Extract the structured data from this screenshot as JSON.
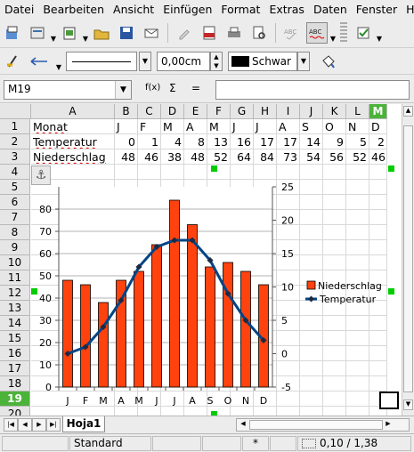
{
  "menu": [
    "Datei",
    "Bearbeiten",
    "Ansicht",
    "Einfügen",
    "Format",
    "Extras",
    "Daten",
    "Fenster",
    "Hilfe"
  ],
  "line_width": "0,00cm",
  "line_color": "Schwar",
  "name_box": "M19",
  "formula_buttons": {
    "function": "f(x)",
    "sum": "Σ",
    "equals": "="
  },
  "columns": [
    "A",
    "B",
    "C",
    "D",
    "E",
    "F",
    "G",
    "H",
    "I",
    "J",
    "K",
    "L",
    "M"
  ],
  "rows": [
    "1",
    "2",
    "3",
    "4",
    "5",
    "6",
    "7",
    "8",
    "9",
    "10",
    "11",
    "12",
    "13",
    "14",
    "15",
    "16",
    "17",
    "18",
    "19",
    "20"
  ],
  "sheet": {
    "row1": [
      "Monat",
      "J",
      "F",
      "M",
      "A",
      "M",
      "J",
      "J",
      "A",
      "S",
      "O",
      "N",
      "D"
    ],
    "row2": [
      "Temperatur",
      "0",
      "1",
      "4",
      "8",
      "13",
      "16",
      "17",
      "17",
      "14",
      "9",
      "5",
      "2"
    ],
    "row3": [
      "Niederschlag",
      "48",
      "46",
      "38",
      "48",
      "52",
      "64",
      "84",
      "73",
      "54",
      "56",
      "52",
      "46"
    ]
  },
  "chart_data": {
    "type": "bar",
    "categories": [
      "J",
      "F",
      "M",
      "A",
      "M",
      "J",
      "J",
      "A",
      "S",
      "O",
      "N",
      "D"
    ],
    "series": [
      {
        "name": "Niederschlag",
        "type": "bar",
        "axis": "left",
        "color": "#ff420e",
        "values": [
          48,
          46,
          38,
          48,
          52,
          64,
          84,
          73,
          54,
          56,
          52,
          46
        ]
      },
      {
        "name": "Temperatur",
        "type": "line",
        "axis": "right",
        "color": "#004586",
        "values": [
          0,
          1,
          4,
          8,
          13,
          16,
          17,
          17,
          14,
          9,
          5,
          2
        ]
      }
    ],
    "y_left": {
      "min": 0,
      "max": 90,
      "ticks": [
        0,
        10,
        20,
        30,
        40,
        50,
        60,
        70,
        80
      ]
    },
    "y_right": {
      "min": -5,
      "max": 25,
      "ticks": [
        -5,
        0,
        5,
        10,
        15,
        20,
        25
      ]
    },
    "legend": "right",
    "grid": true
  },
  "tabs": {
    "active": "Hoja1"
  },
  "status": {
    "style": "Standard",
    "mode": "*",
    "position": "0,10 / 1,38"
  }
}
